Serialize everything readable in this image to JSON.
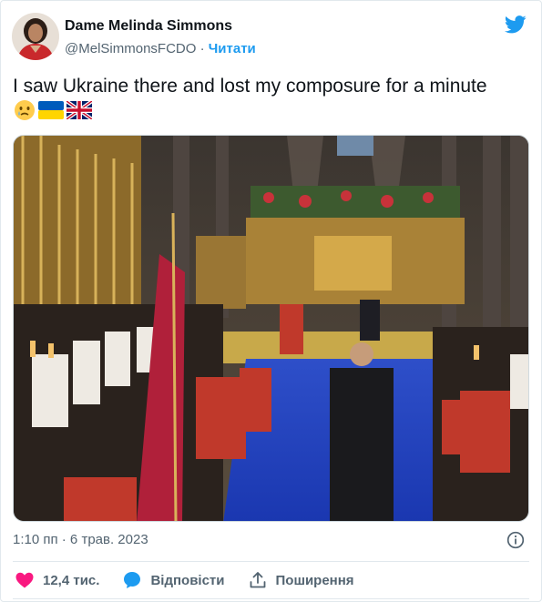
{
  "author": {
    "name": "Dame Melinda Simmons",
    "handle": "@MelSimmonsFCDO",
    "separator": "·",
    "follow_label": "Читати"
  },
  "tweet": {
    "text": "I saw Ukraine there and lost my composure for a minute",
    "emojis": [
      "crying-face-icon",
      "ukraine-flag-icon",
      "uk-flag-icon"
    ]
  },
  "media": {
    "description_icon": "photo-coronation-abbey"
  },
  "meta": {
    "timestamp": "1:10 пп · 6 трав. 2023"
  },
  "actions": {
    "likes_count": "12,4 тис.",
    "reply_label": "Відповісти",
    "share_label": "Поширення"
  },
  "colors": {
    "accent": "#1d9bf0",
    "like": "#f91880",
    "muted": "#536471"
  }
}
